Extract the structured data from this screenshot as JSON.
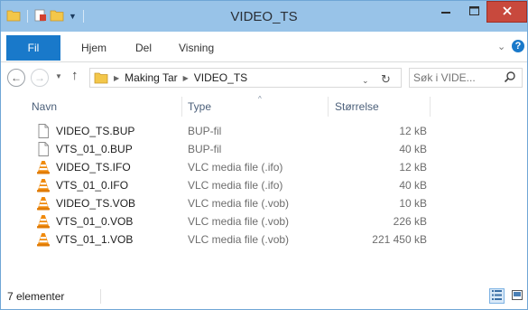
{
  "window": {
    "title": "VIDEO_TS"
  },
  "ribbon": {
    "tabs": [
      "Fil",
      "Hjem",
      "Del",
      "Visning"
    ]
  },
  "address_bar": {
    "breadcrumb": [
      "Making Tar",
      "VIDEO_TS"
    ],
    "search_placeholder": "Søk i VIDE..."
  },
  "columns": {
    "name": "Navn",
    "type": "Type",
    "size": "Størrelse",
    "sorted_by": "Type"
  },
  "files": [
    {
      "name": "VIDEO_TS.BUP",
      "type": "BUP-fil",
      "size": "12 kB",
      "icon": "blank-file-icon"
    },
    {
      "name": "VTS_01_0.BUP",
      "type": "BUP-fil",
      "size": "40 kB",
      "icon": "blank-file-icon"
    },
    {
      "name": "VIDEO_TS.IFO",
      "type": "VLC media file (.ifo)",
      "size": "12 kB",
      "icon": "vlc-cone-icon"
    },
    {
      "name": "VTS_01_0.IFO",
      "type": "VLC media file (.ifo)",
      "size": "40 kB",
      "icon": "vlc-cone-icon"
    },
    {
      "name": "VIDEO_TS.VOB",
      "type": "VLC media file (.vob)",
      "size": "10 kB",
      "icon": "vlc-cone-icon"
    },
    {
      "name": "VTS_01_0.VOB",
      "type": "VLC media file (.vob)",
      "size": "226 kB",
      "icon": "vlc-cone-icon"
    },
    {
      "name": "VTS_01_1.VOB",
      "type": "VLC media file (.vob)",
      "size": "221 450 kB",
      "icon": "vlc-cone-icon"
    }
  ],
  "status_bar": {
    "item_count": "7 elementer",
    "active_view": "details"
  },
  "colors": {
    "titlebar": "#98c3e8",
    "file_tab": "#1979ca",
    "close_button": "#c8493d",
    "vlc_orange": "#f08a0c"
  }
}
